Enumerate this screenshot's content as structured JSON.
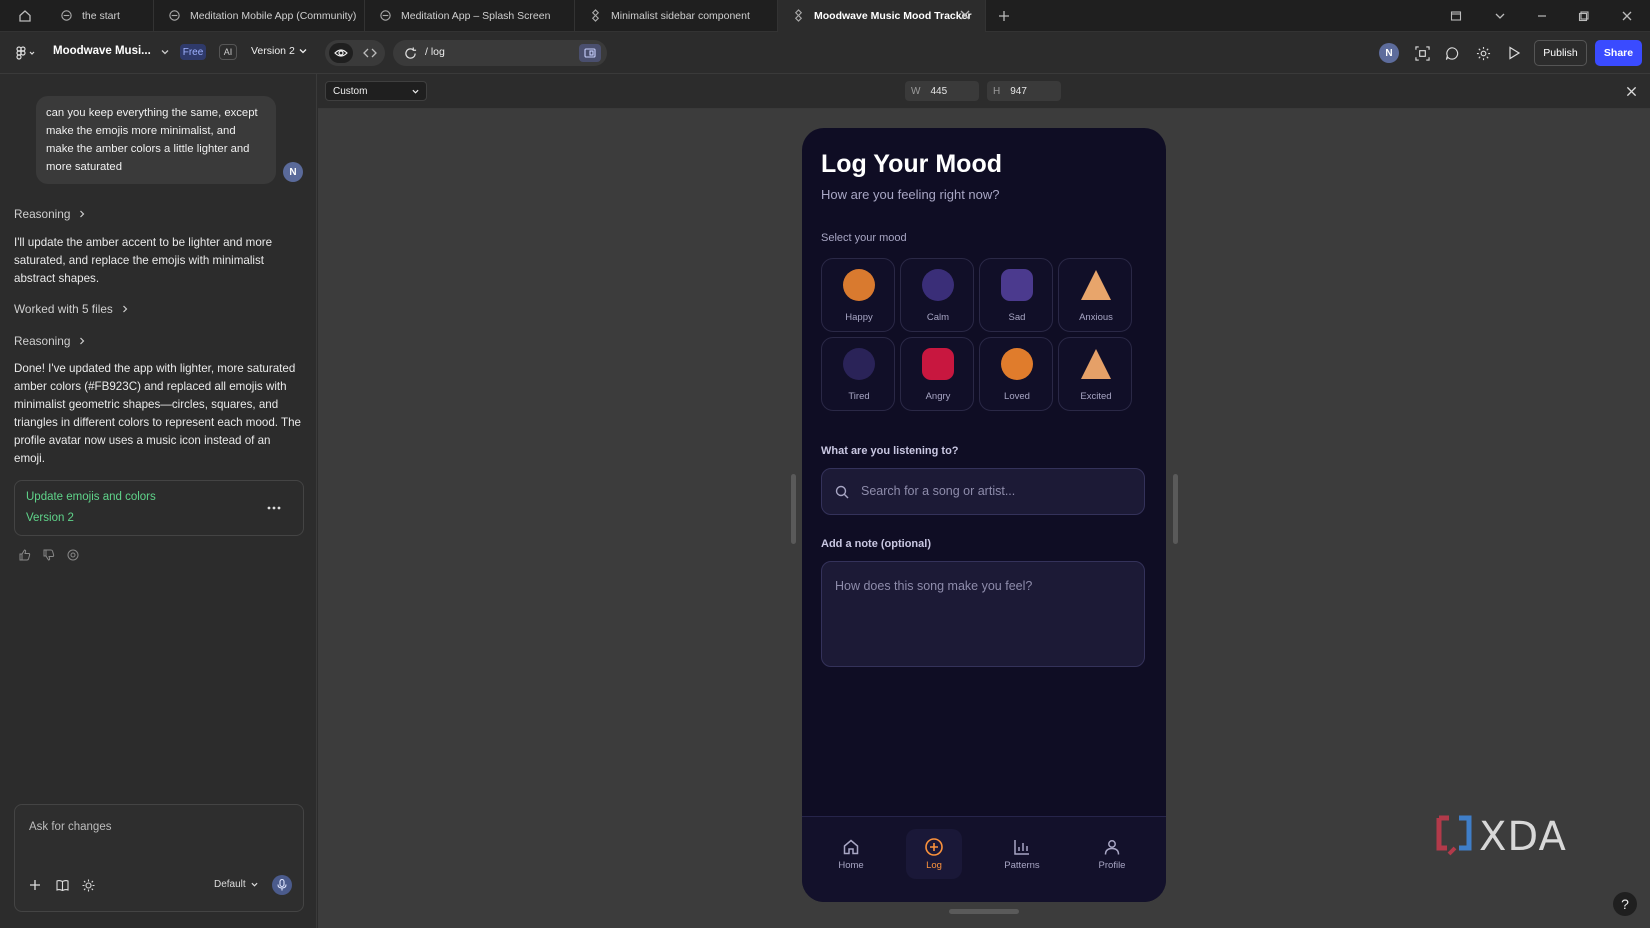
{
  "tabs": [
    {
      "label": "the start",
      "icon": "figma-icon"
    },
    {
      "label": "Meditation Mobile App (Community)",
      "icon": "figma-icon"
    },
    {
      "label": "Meditation App – Splash Screen",
      "icon": "figma-icon"
    },
    {
      "label": "Minimalist sidebar component",
      "icon": "component-icon"
    },
    {
      "label": "Moodwave Music Mood Tracker",
      "icon": "component-icon",
      "active": true
    }
  ],
  "toolbar": {
    "project_name": "Moodwave Musi...",
    "plan_badge": "Free",
    "ai_badge": "AI",
    "version_label": "Version 2",
    "url_path": "/ log",
    "user_initial": "N",
    "publish_label": "Publish",
    "share_label": "Share"
  },
  "chat": {
    "user_message": "can you keep everything the same, except make the emojis more minimalist, and make the amber colors a little lighter and more saturated",
    "user_initial": "N",
    "reasoning_label_1": "Reasoning",
    "response_1": "I'll update the amber accent to be lighter and more saturated, and replace the emojis with minimalist abstract shapes.",
    "worked_files_label": "Worked with 5 files",
    "reasoning_label_2": "Reasoning",
    "response_2": "Done! I've updated the app with lighter, more saturated amber colors (#FB923C) and replaced all emojis with minimalist geometric shapes—circles, squares, and triangles in different colors to represent each mood. The profile avatar now uses a music icon instead of an emoji.",
    "version_card": {
      "title": "Update emojis and colors",
      "version": "Version 2"
    },
    "input_placeholder": "Ask for changes",
    "model_select": "Default"
  },
  "canvas": {
    "device_select": "Custom",
    "width_label": "W",
    "width_value": "445",
    "height_label": "H",
    "height_value": "947"
  },
  "app": {
    "title": "Log Your Mood",
    "subtitle": "How are you feeling right now?",
    "mood_section_label": "Select your mood",
    "moods": [
      {
        "label": "Happy",
        "shape": "circle",
        "color": "#D97A2F"
      },
      {
        "label": "Calm",
        "shape": "circle",
        "color": "#3A2E78"
      },
      {
        "label": "Sad",
        "shape": "rounded-square",
        "color": "#4B3A8E"
      },
      {
        "label": "Anxious",
        "shape": "triangle",
        "color": "#E8A56B"
      },
      {
        "label": "Tired",
        "shape": "circle",
        "color": "#2A2358"
      },
      {
        "label": "Angry",
        "shape": "rounded-square",
        "color": "#C8173F"
      },
      {
        "label": "Loved",
        "shape": "circle",
        "color": "#E07C2C"
      },
      {
        "label": "Excited",
        "shape": "triangle",
        "color": "#E5A068"
      }
    ],
    "listening_label": "What are you listening to?",
    "search_placeholder": "Search for a song or artist...",
    "note_label": "Add a note (optional)",
    "note_placeholder": "How does this song make you feel?",
    "nav": [
      {
        "label": "Home",
        "icon": "home-icon"
      },
      {
        "label": "Log",
        "icon": "plus-circle-icon",
        "active": true
      },
      {
        "label": "Patterns",
        "icon": "bar-chart-icon"
      },
      {
        "label": "Profile",
        "icon": "user-icon"
      }
    ],
    "accent_color": "#FB923C"
  },
  "watermark": "XDA",
  "help_label": "?"
}
